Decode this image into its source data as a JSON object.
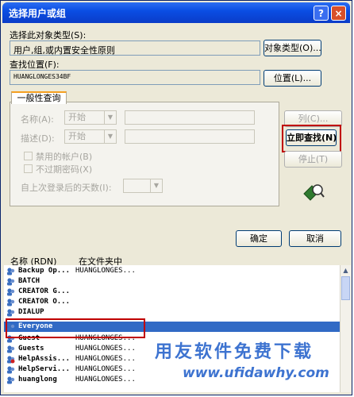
{
  "window": {
    "title": "选择用户或组",
    "help_glyph": "?",
    "close_glyph": "×"
  },
  "object_type": {
    "label": "选择此对象类型(S):",
    "value": "用户,组,或内置安全性原则",
    "button": "对象类型(O)..."
  },
  "location": {
    "label": "查找位置(F):",
    "value": "HUANGLONGES34BF",
    "button": "位置(L)..."
  },
  "query": {
    "tab_label": "一般性查询",
    "name_label": "名称(A):",
    "name_combo": "开始",
    "desc_label": "描述(D):",
    "desc_combo": "开始",
    "disabled_accounts": "禁用的帐户(B)",
    "non_expiring": "不过期密码(X)",
    "days_label": "自上次登录后的天数(I):"
  },
  "side_buttons": {
    "columns": "列(C)...",
    "find_now": "立即查找(N)",
    "stop": "停止(T)"
  },
  "dialog_buttons": {
    "ok": "确定",
    "cancel": "取消"
  },
  "results": {
    "columns": [
      "名称 (RDN)",
      "在文件夹中"
    ],
    "rows": [
      {
        "name": "Backup Op...",
        "folder": "HUANGLONGES...",
        "icon": "group-icon",
        "selected": false
      },
      {
        "name": "BATCH",
        "folder": "",
        "icon": "group-icon",
        "selected": false
      },
      {
        "name": "CREATOR G...",
        "folder": "",
        "icon": "group-icon",
        "selected": false
      },
      {
        "name": "CREATOR O...",
        "folder": "",
        "icon": "group-icon",
        "selected": false
      },
      {
        "name": "DIALUP",
        "folder": "",
        "icon": "group-icon",
        "selected": false
      },
      {
        "name": "Everyone",
        "folder": "",
        "icon": "group-icon",
        "selected": true
      },
      {
        "name": "Guest",
        "folder": "HUANGLONGES...",
        "icon": "user-icon",
        "selected": false
      },
      {
        "name": "Guests",
        "folder": "HUANGLONGES...",
        "icon": "group-icon",
        "selected": false
      },
      {
        "name": "HelpAssis...",
        "folder": "HUANGLONGES...",
        "icon": "user-disabled-icon",
        "selected": false
      },
      {
        "name": "HelpServi...",
        "folder": "HUANGLONGES...",
        "icon": "group-icon",
        "selected": false
      },
      {
        "name": "huanglong",
        "folder": "HUANGLONGES...",
        "icon": "user-icon",
        "selected": false
      }
    ]
  },
  "watermark": {
    "text": "用友软件免费下载",
    "url": "www.ufidawhy.com"
  },
  "colors": {
    "title_bar": "#0a4ee4",
    "selection": "#316ac5",
    "highlight_box": "#c00000",
    "watermark": "#1c5bc8"
  }
}
